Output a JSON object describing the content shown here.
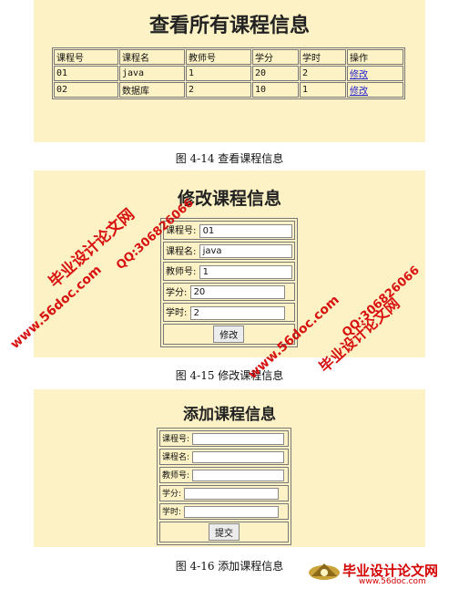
{
  "view_panel": {
    "title": "查看所有课程信息",
    "headers": [
      "课程号",
      "课程名",
      "教师号",
      "学分",
      "学时",
      "操作"
    ],
    "rows": [
      [
        "01",
        "java",
        "1",
        "20",
        "2",
        "修改"
      ],
      [
        "02",
        "数据库",
        "2",
        "10",
        "1",
        "修改"
      ]
    ]
  },
  "caption1": "图 4-14   查看课程信息",
  "edit_panel": {
    "title": "修改课程信息",
    "fields": [
      {
        "label": "课程号:",
        "value": "01"
      },
      {
        "label": "课程名:",
        "value": "java"
      },
      {
        "label": "教师号:",
        "value": "1"
      },
      {
        "label": "学分:",
        "value": "20"
      },
      {
        "label": "学时:",
        "value": "2"
      }
    ],
    "button": "修改"
  },
  "caption2": "图 4-15   修改课程信息",
  "add_panel": {
    "title": "添加课程信息",
    "fields": [
      {
        "label": "课程号:",
        "value": ""
      },
      {
        "label": "课程名:",
        "value": ""
      },
      {
        "label": "教师号:",
        "value": ""
      },
      {
        "label": "学分:",
        "value": ""
      },
      {
        "label": "学时:",
        "value": ""
      }
    ],
    "button": "提交"
  },
  "caption3": "图 4-16   添加课程信息",
  "watermarks": {
    "site_name": "毕业设计论文网",
    "url": "www.56doc.com",
    "qq": "QQ:306826066"
  },
  "colors": {
    "panel_bg": "#fdf2c5",
    "watermark": "#d40000",
    "link": "#2222cc"
  }
}
